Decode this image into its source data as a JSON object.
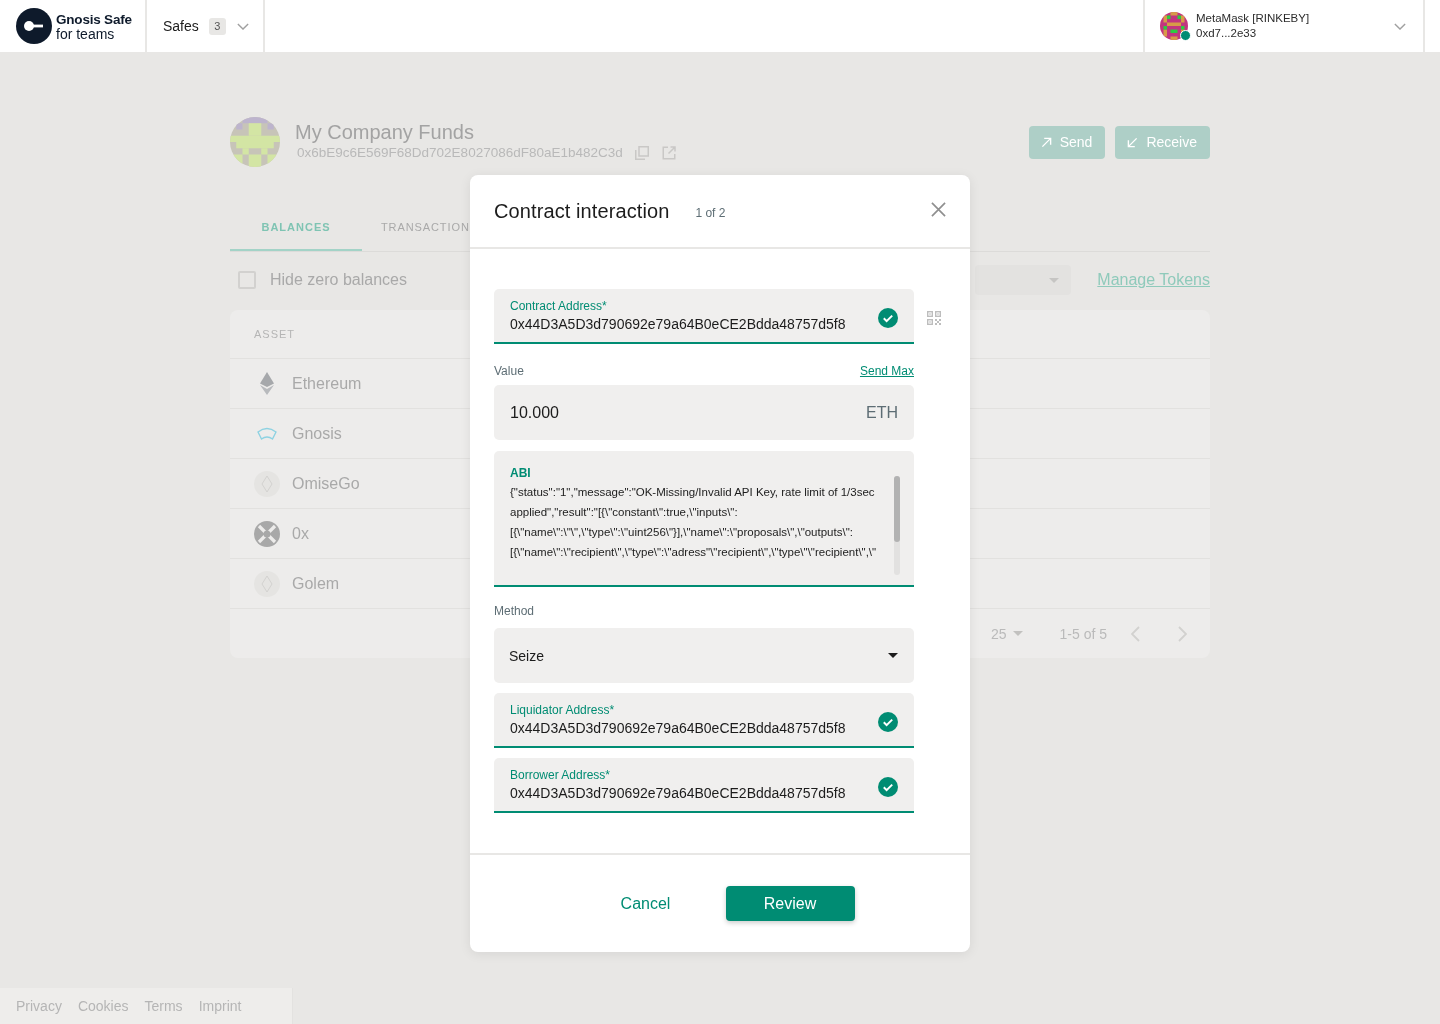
{
  "header": {
    "logo": {
      "title": "Gnosis Safe",
      "subtitle": "for teams"
    },
    "safes_menu": {
      "label": "Safes",
      "count": "3"
    },
    "account": {
      "name": "MetaMask [RINKEBY]",
      "address": "0xd7...2e33",
      "connected": true
    }
  },
  "safe": {
    "name": "My Company Funds",
    "address": "0x6bE9c6E569F68Dd702E8027086dF80aE1b482C3d",
    "actions": [
      {
        "kind": "send",
        "label": "Send"
      },
      {
        "kind": "receive",
        "label": "Receive"
      }
    ]
  },
  "tabs": [
    {
      "label": "BALANCES",
      "selected": true
    },
    {
      "label": "TRANSACTION",
      "selected": false
    }
  ],
  "balances": {
    "hide_zero": {
      "label": "Hide zero balances",
      "checked": false
    },
    "manage_tokens": "Manage Tokens",
    "table": {
      "columns": [
        "ASSET"
      ],
      "rows": [
        {
          "kind": "ether",
          "asset": "Ethereum"
        },
        {
          "kind": "gnosis",
          "asset": "Gnosis"
        },
        {
          "kind": "coin",
          "asset": "OmiseGo"
        },
        {
          "kind": "zerox",
          "asset": "0x"
        },
        {
          "kind": "coin",
          "asset": "Golem"
        }
      ],
      "pagination": {
        "rows_per_page": "25",
        "range": "1-5 of 5"
      }
    }
  },
  "modal": {
    "title": "Contract interaction",
    "step": "1 of 2",
    "fields": [
      {
        "kind": "address",
        "label": "Contract Address*",
        "value": "0x44D3A5D3d790692e79a64B0eCE2Bdda48757d5f8",
        "valid": true,
        "qr_button": true
      },
      {
        "kind": "amount",
        "label": "Value",
        "action": "Send Max",
        "value": "10.000",
        "unit": "ETH"
      },
      {
        "kind": "textarea",
        "label": "ABI",
        "value": "{\"status\":\"1\",\"message\":\"OK-Missing/Invalid API Key, rate limit of 1/3sec applied\",\"result\":\"[{\\\"constant\\\":true,\\\"inputs\\\":[{\\\"name\\\":\\\"\\\",\\\"type\\\":\\\"uint256\\\"}],\\\"name\\\":\\\"proposals\\\",\\\"outputs\\\":[{\\\"name\\\":\\\"recipient\\\",\\\"type\\\":\\\"adress\"\\\"recipient\\\",\\\"type\\\"\\\"recipient\\\",\\\""
      },
      {
        "kind": "select",
        "label": "Method",
        "value": "Seize"
      },
      {
        "kind": "address",
        "label": "Liquidator Address*",
        "value": "0x44D3A5D3d790692e79a64B0eCE2Bdda48757d5f8",
        "valid": true,
        "qr_button": false
      },
      {
        "kind": "address",
        "label": "Borrower Address*",
        "value": "0x44D3A5D3d790692e79a64B0eCE2Bdda48757d5f8",
        "valid": true,
        "qr_button": false
      }
    ],
    "buttons": [
      {
        "kind": "secondary",
        "label": "Cancel"
      },
      {
        "kind": "primary",
        "label": "Review"
      }
    ]
  },
  "footer": {
    "links": [
      "Privacy",
      "Cookies",
      "Terms",
      "Imprint"
    ]
  }
}
